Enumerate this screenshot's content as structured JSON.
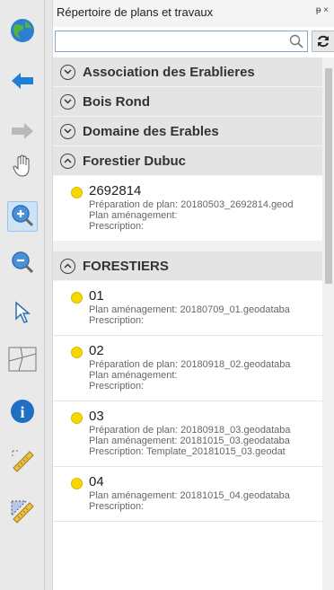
{
  "panel": {
    "title": "Répertoire de plans et travaux",
    "pin_glyph": "ᵽ ×"
  },
  "search": {
    "placeholder": "",
    "value": ""
  },
  "toolbar": {
    "icons": [
      "globe-icon",
      "back-arrow-icon",
      "forward-arrow-icon",
      "pan-hand-icon",
      "zoom-in-icon",
      "zoom-out-icon",
      "select-arrow-icon",
      "polygon-icon",
      "info-icon",
      "ruler-icon",
      "area-measure-icon"
    ],
    "active": "zoom-in-icon"
  },
  "groups": [
    {
      "label": "Association des Erablieres",
      "expanded": false
    },
    {
      "label": "Bois Rond",
      "expanded": false
    },
    {
      "label": "Domaine des Erables",
      "expanded": false
    },
    {
      "label": "Forestier Dubuc",
      "expanded": true,
      "items": [
        {
          "title": "2692814",
          "lines": [
            "Préparation de plan: 20180503_2692814.geod",
            "Plan aménagement:",
            "Prescription:"
          ]
        }
      ]
    },
    {
      "label": "FORESTIERS",
      "expanded": true,
      "items": [
        {
          "title": "01",
          "lines": [
            "Plan aménagement: 20180709_01.geodataba",
            "Prescription:"
          ]
        },
        {
          "title": "02",
          "lines": [
            "Préparation de plan: 20180918_02.geodataba",
            "Plan aménagement:",
            "Prescription:"
          ]
        },
        {
          "title": "03",
          "lines": [
            "Préparation de plan: 20180918_03.geodataba",
            "Plan aménagement: 20181015_03.geodataba",
            "Prescription:  Template_20181015_03.geodat"
          ]
        },
        {
          "title": "04",
          "lines": [
            "Plan aménagement: 20181015_04.geodataba",
            "Prescription:"
          ]
        }
      ]
    }
  ],
  "colors": {
    "status_dot": "#f5d800",
    "active_tool": "#cfe3f7"
  }
}
